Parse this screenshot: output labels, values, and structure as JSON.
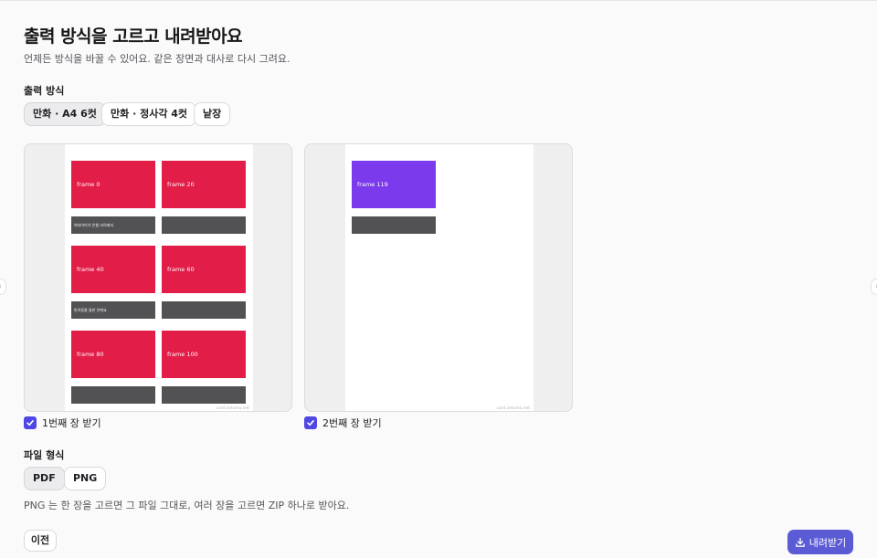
{
  "header": {
    "title": "출력 방식을 고르고 내려받아요",
    "subtitle": "언제든 방식을 바꿀 수 있어요. 같은 장면과 대사로 다시 그려요."
  },
  "output_mode": {
    "label": "출력 방식",
    "options": [
      "만화 · A4 6컷",
      "만화 · 정사각 4컷",
      "낱장"
    ],
    "selected": "만화 · A4 6컷"
  },
  "pages": [
    {
      "frames": [
        "frame 0",
        "frame 20",
        "frame 40",
        "frame 60",
        "frame 80",
        "frame 100"
      ],
      "captions": [
        "여자아이가 인형 사이에서",
        "",
        "반려동물 들판 안에요",
        "",
        "",
        ""
      ],
      "watermark": "card.selumo.net",
      "checkbox_label": "1번째 장 받기",
      "checked": true
    },
    {
      "frames": [
        "frame 119"
      ],
      "captions": [
        ""
      ],
      "watermark": "card.selumo.net",
      "checkbox_label": "2번째 장 받기",
      "checked": true
    }
  ],
  "file_format": {
    "label": "파일 형식",
    "options": [
      "PDF",
      "PNG"
    ],
    "selected": "PDF",
    "hint": "PNG 는 한 장을 고르면 그 파일 그대로, 여러 장을 고르면 ZIP 하나로 받아요."
  },
  "footer": {
    "prev_label": "이전",
    "download_label": "내려받기",
    "download_icon": "download-icon"
  },
  "colors": {
    "accent": "#5b5bd6",
    "frame_red": "#e11d48",
    "frame_purple": "#7c3aed",
    "caption_bg": "#525254"
  }
}
